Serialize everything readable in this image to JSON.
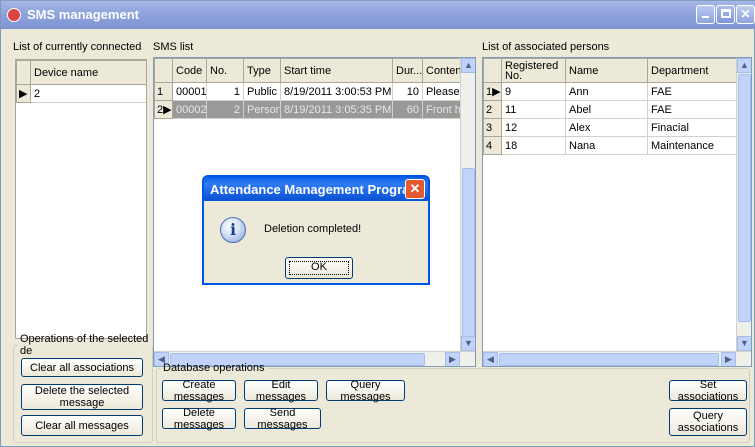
{
  "window": {
    "title": "SMS management"
  },
  "devices": {
    "label": "List of currently connected d",
    "column": "Device name",
    "rows": [
      {
        "marker": "▶",
        "name": "2"
      }
    ]
  },
  "sms": {
    "label": "SMS list",
    "columns": [
      "Code",
      "No.",
      "Type",
      "Start time",
      "Dur...",
      "Content"
    ],
    "rows": [
      {
        "rownum": "1",
        "marker": "",
        "code": "00001",
        "no": "1",
        "type": "Public",
        "start": "8/19/2011 3:00:53 PM",
        "dur": "10",
        "content": "Please c"
      },
      {
        "rownum": "2",
        "marker": "▶",
        "code": "00002",
        "no": "2",
        "type": "Person",
        "start": "8/19/2011 3:05:35 PM",
        "dur": "60",
        "content": "Front ha"
      }
    ]
  },
  "persons": {
    "label": "List of associated persons",
    "columns": [
      "Registered No.",
      "Name",
      "Department"
    ],
    "rows": [
      {
        "rownum": "1",
        "marker": "▶",
        "reg": "9",
        "name": "Ann",
        "dept": "FAE"
      },
      {
        "rownum": "2",
        "marker": "",
        "reg": "11",
        "name": "Abel",
        "dept": "FAE"
      },
      {
        "rownum": "3",
        "marker": "",
        "reg": "12",
        "name": "Alex",
        "dept": "Finacial"
      },
      {
        "rownum": "4",
        "marker": "",
        "reg": "18",
        "name": "Nana",
        "dept": "Maintenance"
      }
    ]
  },
  "ops": {
    "legend": "Operations of the selected de",
    "clear_assoc": "Clear all associations",
    "delete_selected": "Delete the selected message",
    "clear_messages": "Clear all messages"
  },
  "db": {
    "legend": "Database operations",
    "create": "Create messages",
    "edit": "Edit messages",
    "query": "Query messages",
    "delete": "Delete messages",
    "send": "Send messages",
    "set_assoc": "Set associations",
    "query_assoc": "Query associations"
  },
  "dialog": {
    "title": "Attendance Management Program",
    "message": "Deletion completed!",
    "ok": "OK"
  }
}
